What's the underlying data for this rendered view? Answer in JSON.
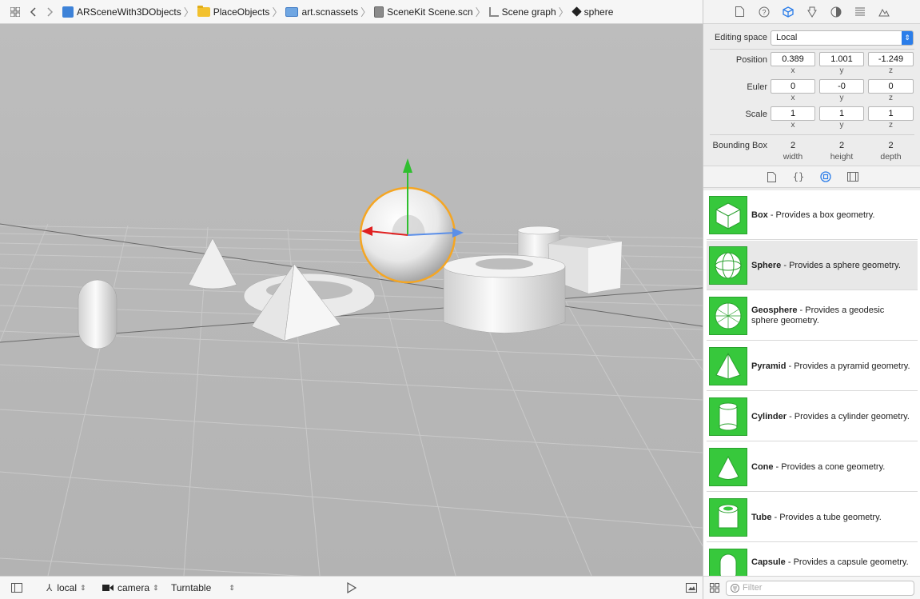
{
  "jumpbar": {
    "crumbs": [
      {
        "label": "ARSceneWith3DObjects",
        "icon": "project-icon"
      },
      {
        "label": "PlaceObjects",
        "icon": "folder-icon"
      },
      {
        "label": "art.scnassets",
        "icon": "assets-folder-icon"
      },
      {
        "label": "SceneKit Scene.scn",
        "icon": "scene-file-icon"
      },
      {
        "label": "Scene graph",
        "icon": "scene-graph-icon"
      },
      {
        "label": "sphere",
        "icon": "node-cube-icon"
      }
    ]
  },
  "bottombar": {
    "space": "local",
    "camera": "camera",
    "mode": "Turntable"
  },
  "inspector": {
    "editing_space_label": "Editing space",
    "editing_space_value": "Local",
    "position": {
      "label": "Position",
      "x": "0.389",
      "y": "1.001",
      "z": "-1.249"
    },
    "euler": {
      "label": "Euler",
      "x": "0",
      "y": "-0",
      "z": "0"
    },
    "scale": {
      "label": "Scale",
      "x": "1",
      "y": "1",
      "z": "1"
    },
    "axis": {
      "x": "x",
      "y": "y",
      "z": "z"
    },
    "bbox": {
      "label": "Bounding Box",
      "width": "2",
      "height": "2",
      "depth": "2",
      "width_label": "width",
      "height_label": "height",
      "depth_label": "depth"
    }
  },
  "library": {
    "items": [
      {
        "name": "Box",
        "desc": " - Provides a box geometry."
      },
      {
        "name": "Sphere",
        "desc": " - Provides a sphere geometry."
      },
      {
        "name": "Geosphere",
        "desc": " - Provides a geodesic sphere geometry."
      },
      {
        "name": "Pyramid",
        "desc": " - Provides a pyramid geometry."
      },
      {
        "name": "Cylinder",
        "desc": " - Provides a cylinder geometry."
      },
      {
        "name": "Cone",
        "desc": " - Provides a cone geometry."
      },
      {
        "name": "Tube",
        "desc": " - Provides a tube geometry."
      },
      {
        "name": "Capsule",
        "desc": " - Provides a capsule geometry."
      }
    ],
    "selected_index": 1,
    "filter_placeholder": "Filter"
  },
  "colors": {
    "selection": "#f5a623",
    "thumb": "#37c83c",
    "accent": "#2b7de9"
  }
}
